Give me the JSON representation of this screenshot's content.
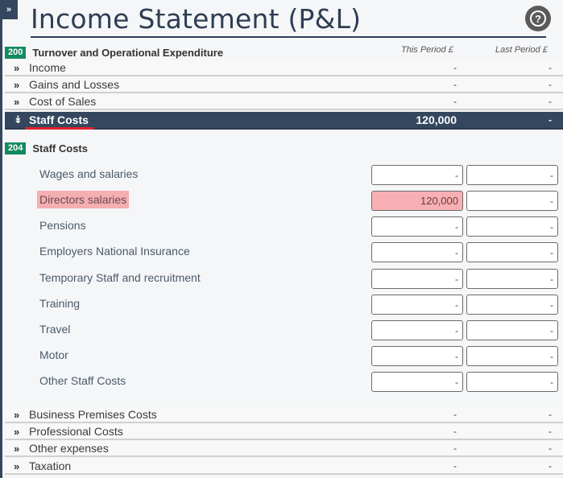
{
  "page": {
    "title": "Income Statement (P&L)",
    "sidebar_toggle_icon": "»",
    "help_icon": "?"
  },
  "section": {
    "code": "200",
    "title": "Turnover and Operational Expenditure",
    "columns": [
      "This Period £",
      "Last Period £"
    ]
  },
  "categories_top": [
    {
      "label": "Income",
      "this_period": "-",
      "last_period": "-",
      "icon": "chevron-double-right"
    },
    {
      "label": "Gains and Losses",
      "this_period": "-",
      "last_period": "-",
      "icon": "chevron-double-right"
    },
    {
      "label": "Cost of Sales",
      "this_period": "-",
      "last_period": "-",
      "icon": "chevron-double-right"
    }
  ],
  "active_category": {
    "label": "Staff Costs",
    "this_period": "120,000",
    "last_period": "-",
    "icon": "chevron-double-down",
    "expanded": true
  },
  "subsection": {
    "code": "204",
    "title": "Staff Costs",
    "items": [
      {
        "label": "Wages and salaries",
        "this_period": "-",
        "last_period": "-",
        "highlighted": false
      },
      {
        "label": "Directors salaries",
        "this_period": "120,000",
        "last_period": "-",
        "highlighted": true
      },
      {
        "label": "Pensions",
        "this_period": "-",
        "last_period": "-",
        "highlighted": false
      },
      {
        "label": "Employers National Insurance",
        "this_period": "-",
        "last_period": "-",
        "highlighted": false
      },
      {
        "label": "Temporary Staff and recruitment",
        "this_period": "-",
        "last_period": "-",
        "highlighted": false
      },
      {
        "label": "Training",
        "this_period": "-",
        "last_period": "-",
        "highlighted": false
      },
      {
        "label": "Travel",
        "this_period": "-",
        "last_period": "-",
        "highlighted": false
      },
      {
        "label": "Motor",
        "this_period": "-",
        "last_period": "-",
        "highlighted": false
      },
      {
        "label": "Other Staff Costs",
        "this_period": "-",
        "last_period": "-",
        "highlighted": false
      }
    ]
  },
  "categories_bottom": [
    {
      "label": "Business Premises Costs",
      "this_period": "-",
      "last_period": "-",
      "icon": "chevron-double-right"
    },
    {
      "label": "Professional Costs",
      "this_period": "-",
      "last_period": "-",
      "icon": "chevron-double-right"
    },
    {
      "label": "Other expenses",
      "this_period": "-",
      "last_period": "-",
      "icon": "chevron-double-right"
    },
    {
      "label": "Taxation",
      "this_period": "-",
      "last_period": "-",
      "icon": "chevron-double-right"
    }
  ],
  "colors": {
    "navy": "#34475e",
    "badge_green": "#148a5e",
    "highlight_pink": "#f5aeb2",
    "annotation_red": "#e0202a"
  }
}
